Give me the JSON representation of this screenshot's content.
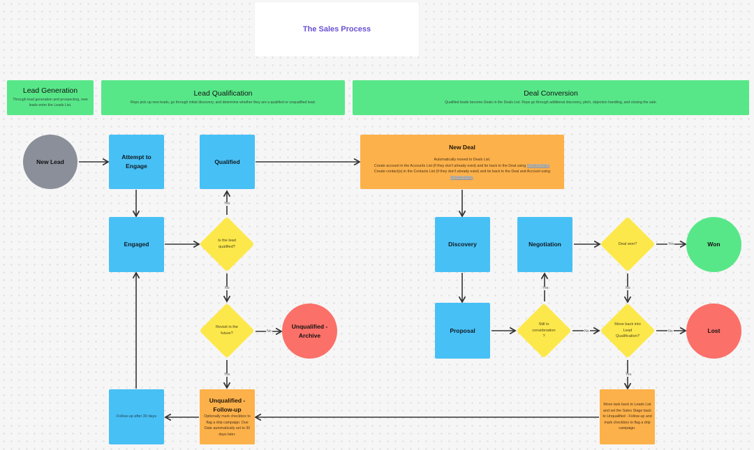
{
  "title": "The Sales Process",
  "colors": {
    "title": "#6a4fd1",
    "phase_header": "#58e788",
    "step_box": "#47c0f5",
    "note_box": "#fdb14a",
    "decision": "#fde84b",
    "start": "#8a8f99",
    "won": "#58e788",
    "lost": "#fb7068",
    "connector": "#333333"
  },
  "phases": [
    {
      "title": "Lead Generation",
      "description": "Through lead generation and prospecting, new leads enter the Leads List."
    },
    {
      "title": "Lead Qualification",
      "description": "Reps pick up new leads, go through initial discovery, and determine whether they are a qualified or unqualified lead."
    },
    {
      "title": "Deal Conversion",
      "description": "Qualified leads become Deals in the Deals List. Reps go through additional discovery, pitch, objection handling, and closing the sale."
    }
  ],
  "nodes": {
    "new_lead": "New Lead",
    "attempt_to_engage": "Attempt to Engage",
    "qualified": "Qualified",
    "engaged": "Engaged",
    "is_lead_qualified": "Is the lead qualified?",
    "revisit_future": "Revisit in the future?",
    "unqualified_archive": "Unqualified - Archive",
    "follow_up_30": "Follow-up after 30 days",
    "unqualified_followup": {
      "title": "Unqualified - Follow-up",
      "body": "Optionally mark checkbox to flag a drip campaign. Due Date automatically set to 30 days later."
    },
    "new_deal": {
      "title": "New Deal",
      "line1": "Automatically moved to Deals List.",
      "line2": "Create account in the Accounts List (if they don't already exist) and tie back to the Deal using",
      "line2_link": "Relationships",
      "line3": "Create contact(s) in the Contacts List (if they don't already exist) and tie back to the Deal and Account using",
      "line3_link": "Relationships"
    },
    "discovery": "Discovery",
    "negotiation": "Negotiation",
    "proposal": "Proposal",
    "deal_won_q": "Deal won?",
    "won": "Won",
    "still_consideration": "Still in consideration ?",
    "move_back_q": "Move back into Lead Qualification?",
    "lost": "Lost",
    "move_task_back": "Move task back to Leads List and set the Sales Stage back to Unqualified - Follow-up and mark checkbox to flag a drip campaign."
  },
  "edge_labels": {
    "yes": "Yes",
    "no": "No"
  }
}
